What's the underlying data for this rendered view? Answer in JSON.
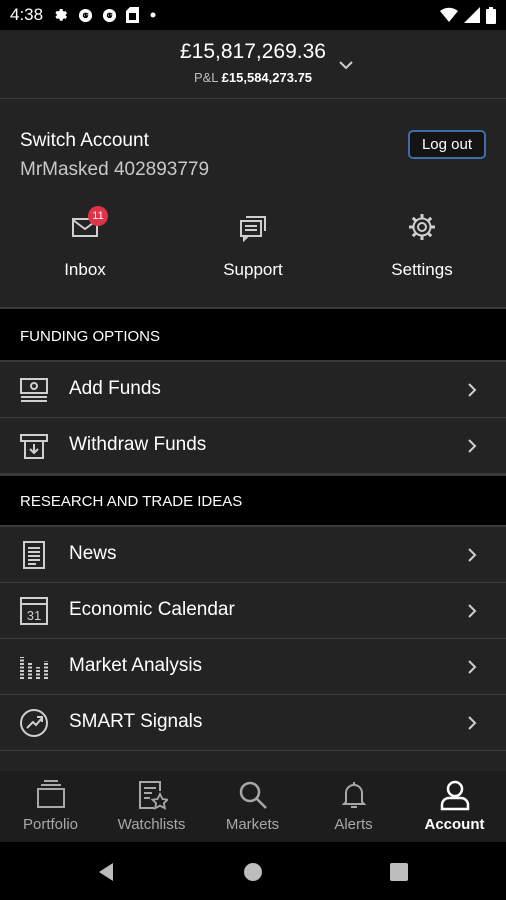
{
  "status_bar": {
    "time": "4:38",
    "icons": [
      "gear-icon",
      "g-logo-icon",
      "g-logo-icon",
      "sim-card-icon",
      "dot-icon"
    ],
    "right_icons": [
      "wifi-icon",
      "signal-icon",
      "battery-icon"
    ]
  },
  "header": {
    "balance": "£15,817,269.36",
    "pnl_label": "P&L",
    "pnl_value": "£15,584,273.75"
  },
  "account": {
    "switch_label": "Switch Account",
    "account_id": "MrMasked 402893779",
    "logout_label": "Log out"
  },
  "quick_actions": [
    {
      "label": "Inbox",
      "icon": "mail-icon",
      "badge": "11"
    },
    {
      "label": "Support",
      "icon": "chat-icon"
    },
    {
      "label": "Settings",
      "icon": "gear-icon"
    }
  ],
  "sections": {
    "funding": {
      "title": "FUNDING OPTIONS",
      "items": [
        {
          "label": "Add Funds",
          "icon": "cash-icon"
        },
        {
          "label": "Withdraw Funds",
          "icon": "withdraw-icon"
        }
      ]
    },
    "research": {
      "title": "RESEARCH AND TRADE IDEAS",
      "items": [
        {
          "label": "News",
          "icon": "news-icon"
        },
        {
          "label": "Economic Calendar",
          "icon": "calendar-icon",
          "calendar_day": "31"
        },
        {
          "label": "Market Analysis",
          "icon": "analysis-icon"
        },
        {
          "label": "SMART Signals",
          "icon": "signals-icon"
        }
      ]
    }
  },
  "tabs": [
    {
      "label": "Portfolio",
      "icon": "portfolio-icon",
      "active": false
    },
    {
      "label": "Watchlists",
      "icon": "watchlist-icon",
      "active": false
    },
    {
      "label": "Markets",
      "icon": "search-icon",
      "active": false
    },
    {
      "label": "Alerts",
      "icon": "bell-icon",
      "active": false
    },
    {
      "label": "Account",
      "icon": "account-icon",
      "active": true
    }
  ],
  "colors": {
    "background": "#232323",
    "section_header": "#000000",
    "accent_border": "#3d6ea6",
    "badge": "#e0334a"
  }
}
